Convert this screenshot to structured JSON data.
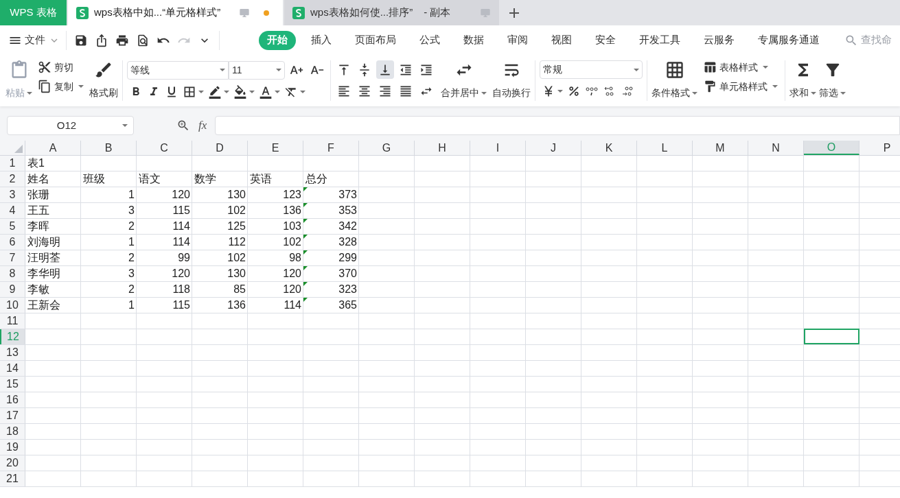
{
  "app_tab": "WPS 表格",
  "doc_tabs": [
    {
      "title": "wps表格中如...“单元格样式”",
      "selected": true,
      "unsaved": true
    },
    {
      "title": "wps表格如何使...排序”",
      "suffix": "- 副本",
      "selected": false,
      "unsaved": false
    }
  ],
  "menu": {
    "file": "文件",
    "quick_tools": [
      {
        "kind": "save",
        "disabled": false
      },
      {
        "kind": "export",
        "disabled": false
      },
      {
        "kind": "print",
        "disabled": false
      },
      {
        "kind": "preview",
        "disabled": false
      },
      {
        "kind": "undo",
        "disabled": false
      },
      {
        "kind": "redo",
        "disabled": true
      },
      {
        "kind": "more",
        "disabled": false
      }
    ],
    "tabs": [
      {
        "label": "开始",
        "selected": true
      },
      {
        "label": "插入",
        "selected": false
      },
      {
        "label": "页面布局",
        "selected": false
      },
      {
        "label": "公式",
        "selected": false
      },
      {
        "label": "数据",
        "selected": false
      },
      {
        "label": "审阅",
        "selected": false
      },
      {
        "label": "视图",
        "selected": false
      },
      {
        "label": "安全",
        "selected": false
      },
      {
        "label": "开发工具",
        "selected": false
      },
      {
        "label": "云服务",
        "selected": false
      },
      {
        "label": "专属服务通道",
        "selected": false
      }
    ],
    "search_placeholder": "查找命"
  },
  "ribbon": {
    "paste": {
      "label": "粘贴",
      "disabled": true
    },
    "cut": "剪切",
    "copy": "复制",
    "format_painter": "格式刷",
    "font_name": "等线",
    "font_size": "11",
    "alignment": [
      {
        "kind": "top",
        "selected": false
      },
      {
        "kind": "middle",
        "selected": false
      },
      {
        "kind": "bottom",
        "selected": true
      },
      {
        "kind": "outdent",
        "selected": false
      },
      {
        "kind": "indent",
        "selected": false
      },
      {
        "kind": "left",
        "selected": false
      },
      {
        "kind": "center",
        "selected": false
      },
      {
        "kind": "right",
        "selected": false
      },
      {
        "kind": "justify",
        "selected": false
      },
      {
        "kind": "distributed",
        "selected": false
      }
    ],
    "merge": "合并居中",
    "wrap": "自动换行",
    "number_format": "常规",
    "conditional": "条件格式",
    "table_style": "表格样式",
    "cell_style": "单元格样式",
    "sum": "求和",
    "filter": "筛选"
  },
  "formula_bar": {
    "name_box": "O12",
    "fx": "fx"
  },
  "columns": [
    {
      "label": "A",
      "selected": false
    },
    {
      "label": "B",
      "selected": false
    },
    {
      "label": "C",
      "selected": false
    },
    {
      "label": "D",
      "selected": false
    },
    {
      "label": "E",
      "selected": false
    },
    {
      "label": "F",
      "selected": false
    },
    {
      "label": "G",
      "selected": false
    },
    {
      "label": "H",
      "selected": false
    },
    {
      "label": "I",
      "selected": false
    },
    {
      "label": "J",
      "selected": false
    },
    {
      "label": "K",
      "selected": false
    },
    {
      "label": "L",
      "selected": false
    },
    {
      "label": "M",
      "selected": false
    },
    {
      "label": "N",
      "selected": false
    },
    {
      "label": "O",
      "selected": true
    },
    {
      "label": "P",
      "selected": false
    }
  ],
  "rows": [
    {
      "label": "1",
      "selected": false,
      "cells": [
        {
          "text": "表1",
          "kind": "text",
          "flag": false
        }
      ]
    },
    {
      "label": "2",
      "selected": false,
      "cells": [
        {
          "text": "姓名",
          "kind": "text",
          "flag": false
        },
        {
          "text": "班级",
          "kind": "text",
          "flag": false
        },
        {
          "text": "语文",
          "kind": "text",
          "flag": false
        },
        {
          "text": "数学",
          "kind": "text",
          "flag": false
        },
        {
          "text": "英语",
          "kind": "text",
          "flag": false
        },
        {
          "text": "总分",
          "kind": "text",
          "flag": false
        }
      ]
    },
    {
      "label": "3",
      "selected": false,
      "cells": [
        {
          "text": "张珊",
          "kind": "text",
          "flag": false
        },
        {
          "text": "1",
          "kind": "number",
          "flag": false
        },
        {
          "text": "120",
          "kind": "number",
          "flag": false
        },
        {
          "text": "130",
          "kind": "number",
          "flag": false
        },
        {
          "text": "123",
          "kind": "number",
          "flag": false
        },
        {
          "text": "373",
          "kind": "number",
          "flag": true
        }
      ]
    },
    {
      "label": "4",
      "selected": false,
      "cells": [
        {
          "text": "王五",
          "kind": "text",
          "flag": false
        },
        {
          "text": "3",
          "kind": "number",
          "flag": false
        },
        {
          "text": "115",
          "kind": "number",
          "flag": false
        },
        {
          "text": "102",
          "kind": "number",
          "flag": false
        },
        {
          "text": "136",
          "kind": "number",
          "flag": false
        },
        {
          "text": "353",
          "kind": "number",
          "flag": true
        }
      ]
    },
    {
      "label": "5",
      "selected": false,
      "cells": [
        {
          "text": "李晖",
          "kind": "text",
          "flag": false
        },
        {
          "text": "2",
          "kind": "number",
          "flag": false
        },
        {
          "text": "114",
          "kind": "number",
          "flag": false
        },
        {
          "text": "125",
          "kind": "number",
          "flag": false
        },
        {
          "text": "103",
          "kind": "number",
          "flag": false
        },
        {
          "text": "342",
          "kind": "number",
          "flag": true
        }
      ]
    },
    {
      "label": "6",
      "selected": false,
      "cells": [
        {
          "text": "刘海明",
          "kind": "text",
          "flag": false
        },
        {
          "text": "1",
          "kind": "number",
          "flag": false
        },
        {
          "text": "114",
          "kind": "number",
          "flag": false
        },
        {
          "text": "112",
          "kind": "number",
          "flag": false
        },
        {
          "text": "102",
          "kind": "number",
          "flag": false
        },
        {
          "text": "328",
          "kind": "number",
          "flag": true
        }
      ]
    },
    {
      "label": "7",
      "selected": false,
      "cells": [
        {
          "text": "汪明荃",
          "kind": "text",
          "flag": false
        },
        {
          "text": "2",
          "kind": "number",
          "flag": false
        },
        {
          "text": "99",
          "kind": "number",
          "flag": false
        },
        {
          "text": "102",
          "kind": "number",
          "flag": false
        },
        {
          "text": "98",
          "kind": "number",
          "flag": false
        },
        {
          "text": "299",
          "kind": "number",
          "flag": true
        }
      ]
    },
    {
      "label": "8",
      "selected": false,
      "cells": [
        {
          "text": "李华明",
          "kind": "text",
          "flag": false
        },
        {
          "text": "3",
          "kind": "number",
          "flag": false
        },
        {
          "text": "120",
          "kind": "number",
          "flag": false
        },
        {
          "text": "130",
          "kind": "number",
          "flag": false
        },
        {
          "text": "120",
          "kind": "number",
          "flag": false
        },
        {
          "text": "370",
          "kind": "number",
          "flag": true
        }
      ]
    },
    {
      "label": "9",
      "selected": false,
      "cells": [
        {
          "text": "李敏",
          "kind": "text",
          "flag": false
        },
        {
          "text": "2",
          "kind": "number",
          "flag": false
        },
        {
          "text": "118",
          "kind": "number",
          "flag": false
        },
        {
          "text": "85",
          "kind": "number",
          "flag": false
        },
        {
          "text": "120",
          "kind": "number",
          "flag": false
        },
        {
          "text": "323",
          "kind": "number",
          "flag": true
        }
      ]
    },
    {
      "label": "10",
      "selected": false,
      "cells": [
        {
          "text": "王新会",
          "kind": "text",
          "flag": false
        },
        {
          "text": "1",
          "kind": "number",
          "flag": false
        },
        {
          "text": "115",
          "kind": "number",
          "flag": false
        },
        {
          "text": "136",
          "kind": "number",
          "flag": false
        },
        {
          "text": "114",
          "kind": "number",
          "flag": false
        },
        {
          "text": "365",
          "kind": "number",
          "flag": true
        }
      ]
    },
    {
      "label": "11",
      "selected": false
    },
    {
      "label": "12",
      "selected": true
    },
    {
      "label": "13",
      "selected": false
    },
    {
      "label": "14",
      "selected": false
    },
    {
      "label": "15",
      "selected": false
    },
    {
      "label": "16",
      "selected": false
    },
    {
      "label": "17",
      "selected": false
    },
    {
      "label": "18",
      "selected": false
    },
    {
      "label": "19",
      "selected": false
    },
    {
      "label": "20",
      "selected": false
    },
    {
      "label": "21",
      "selected": false
    }
  ]
}
